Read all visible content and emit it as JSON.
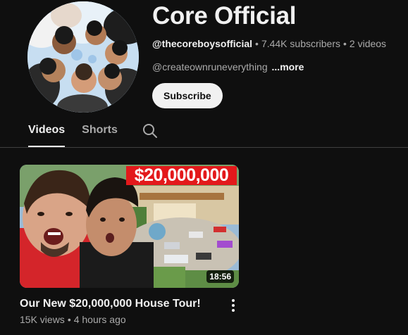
{
  "channel": {
    "name": "Core Official",
    "handle": "@thecoreboysofficial",
    "subscribers": "7.44K subscribers",
    "video_count": "2 videos",
    "description": "@createownruneverything",
    "more_label": "...more",
    "subscribe_label": "Subscribe",
    "avatar": "group-photo-avatar"
  },
  "tabs": [
    {
      "label": "Videos",
      "active": true
    },
    {
      "label": "Shorts",
      "active": false
    }
  ],
  "search_icon": "search-icon",
  "video": {
    "title": "Our New $20,000,000 House Tour!",
    "views": "15K views",
    "age": "4 hours ago",
    "duration": "18:56",
    "thumbnail_text": "$20,000,000",
    "menu_icon": "more-vert-icon"
  },
  "colors": {
    "background": "#0f0f0f",
    "text_primary": "#f1f1f1",
    "text_secondary": "#aaaaaa",
    "thumbnail_badge": "#e3191b"
  }
}
